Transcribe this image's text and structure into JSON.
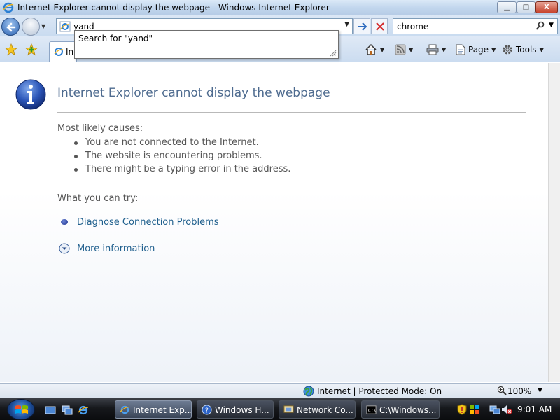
{
  "window": {
    "title": "Internet Explorer cannot display the webpage - Windows Internet Explorer",
    "controls": [
      "minimize",
      "maximize",
      "close"
    ]
  },
  "navigation": {
    "address_value": "yand",
    "search_value": "chrome",
    "autocomplete_item": "Search for \"yand\""
  },
  "command_bar": {
    "tab_label": "Internet Explorer cannot display the webpage",
    "page_label": "Page",
    "tools_label": "Tools"
  },
  "error_page": {
    "title": "Internet Explorer cannot display the webpage",
    "causes_heading": "Most likely causes:",
    "causes": [
      "You are not connected to the Internet.",
      "The website is encountering problems.",
      "There might be a typing error in the address."
    ],
    "try_heading": "What you can try:",
    "diagnose_link": "Diagnose Connection Problems",
    "more_info_link": "More information"
  },
  "status_bar": {
    "zone": "Internet | Protected Mode: On",
    "zoom": "100%"
  },
  "taskbar": {
    "tasks": [
      {
        "label": "Internet Exp...",
        "active": true
      },
      {
        "label": "Windows H...",
        "active": false
      },
      {
        "label": "Network Co...",
        "active": false
      },
      {
        "label": "C:\\Windows...",
        "active": false
      }
    ],
    "clock": "9:01 AM"
  },
  "colors": {
    "link": "#1f5f8d",
    "title_text": "#4e6b8f",
    "body_text": "#555555"
  }
}
